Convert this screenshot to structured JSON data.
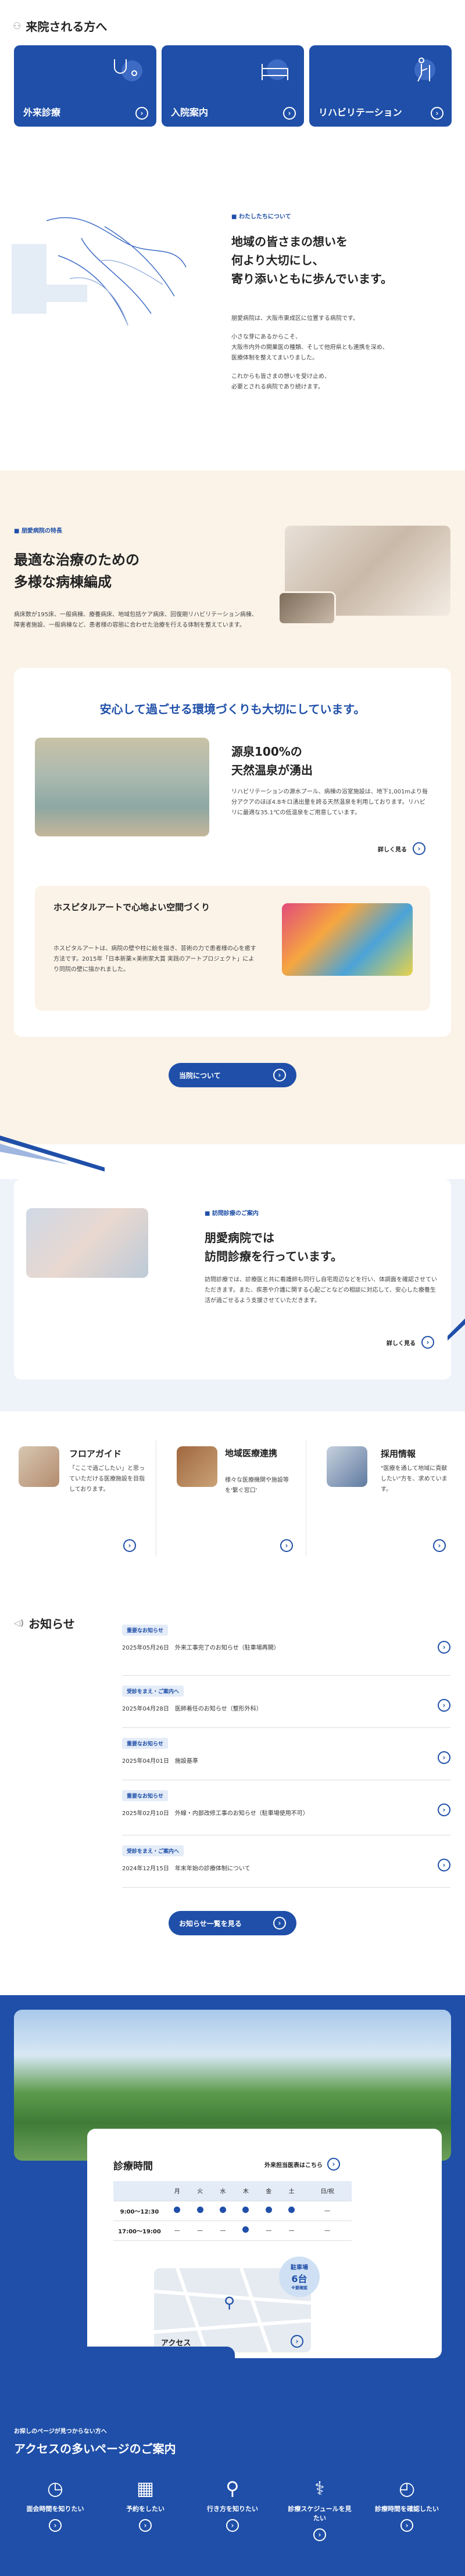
{
  "top": {
    "heading": "来院される方へ",
    "cards": [
      {
        "label": "外来診療"
      },
      {
        "label": "入院案内"
      },
      {
        "label": "リハビリテーション"
      }
    ]
  },
  "about": {
    "tag": "わたしたちについて",
    "title_line1": "地域の皆さまの想いを",
    "title_line2": "何より大切にし、",
    "title_line3": "寄り添いともに歩んでいます。",
    "p1": "朋愛病院は、大阪市東成区に位置する病院です。",
    "p2a": "小さな芽にあるからこそ、",
    "p2b": "大阪市内外の開業医の種類、そして他府県とも連携を深め、",
    "p2c": "医療体制を整えてまいりました。",
    "p3a": "これからも皆さまの想いを受け止め、",
    "p3b": "必要とされる病院であり続けます。"
  },
  "features": {
    "tag": "朋愛病院の特長",
    "title_line1": "最適な治療のための",
    "title_line2": "多様な病棟編成",
    "body": "病床数が195床、一般病棟、療養病床、地域包括ケア病床、回復期リハビリテーション病棟、障害者施設、一般病棟など、患者様の容態に合わせた治療を行える体制を整えています。",
    "box_title": "安心して過ごせる環境づくりも大切にしています。",
    "onsen_title1": "源泉100%の",
    "onsen_title2": "天然温泉が湧出",
    "onsen_body": "リハビリテーションの源水プール、病棟の浴室施設は、地下1,001mより毎分アクアのほぼ4.8キロ湧出量を誇る天然温泉を利用しております。リハビリに最適な35.1℃の低温泉をご用意しています。",
    "onsen_more": "詳しく見る",
    "art_title": "ホスピタルアートで心地よい空間づくり",
    "art_body": "ホスピタルアートは、病院の壁や柱に絵を描き、芸術の力で患者様の心を癒す方法です。2015年「日本新薬×美術家大賞 実践のアートプロジェクト」により同院の壁に描かれました。",
    "about_btn": "当院について"
  },
  "visit": {
    "tag": "訪問診療のご案内",
    "title_line1": "朋愛病院では",
    "title_line2": "訪問診療を行っています。",
    "body": "訪問診療では、診療医と共に看護師も同行し自宅周辺などを行い、体調面を確認させていただきます。また、疾患や介護に関する心配ごとなどの相談に対応して、安心した療養生活が過ごせるよう支援させていただきます。",
    "more": "詳しく見る"
  },
  "guides": [
    {
      "title": "フロアガイド",
      "body": "「ここで過ごしたい」と思っていただける医療施設を目指しております。"
    },
    {
      "title": "地域医療連携",
      "body": "様々な医療機関や施設等を'繋ぐ窓口'"
    },
    {
      "title": "採用情報",
      "body": "\"医療を通して地域に貢献したい\"方を、求めています。"
    }
  ],
  "news": {
    "heading": "お知らせ",
    "items": [
      {
        "tag": "重要なお知らせ",
        "date": "2025年05月26日",
        "text": "外来工事完了のお知らせ（駐車場再開）"
      },
      {
        "tag": "受診をまえ・ご案内へ",
        "date": "2025年04月28日",
        "text": "医師着任のお知らせ（整形外科）"
      },
      {
        "tag": "重要なお知らせ",
        "date": "2025年04月01日",
        "text": "施設基準"
      },
      {
        "tag": "重要なお知らせ",
        "date": "2025年02月10日",
        "text": "外線・内部改修工事のお知らせ（駐車場使用不可）"
      },
      {
        "tag": "受診をまえ・ご案内へ",
        "date": "2024年12月15日",
        "text": "年末年始の診療体制について"
      }
    ],
    "more_btn": "お知らせ一覧を見る"
  },
  "hours": {
    "title": "診療時間",
    "link": "外来担当医表はこちら",
    "days": [
      "月",
      "火",
      "水",
      "木",
      "金",
      "土",
      "日/祝"
    ],
    "row1_label": "9:00〜12:30",
    "row2_label": "17:00〜19:00",
    "dash": "—",
    "row1": [
      1,
      1,
      1,
      1,
      1,
      1,
      0
    ],
    "row2": [
      0,
      0,
      0,
      1,
      0,
      0,
      0
    ],
    "parking_l1": "駐車場",
    "parking_l2": "6台",
    "parking_l3": "※要確認",
    "access": "アクセス"
  },
  "bottom": {
    "sub": "お探しのページが見つからない方へ",
    "title": "アクセスの多いページのご案内",
    "items": [
      {
        "label": "面会時間を知りたい"
      },
      {
        "label": "予約をしたい"
      },
      {
        "label": "行き方を知りたい"
      },
      {
        "label": "診療スケジュールを見たい"
      },
      {
        "label": "診療時間を確認したい"
      }
    ]
  },
  "colors": {
    "primary": "#1f4fa8",
    "cream": "#fbf3e8",
    "lightblue": "#eef3f9"
  }
}
